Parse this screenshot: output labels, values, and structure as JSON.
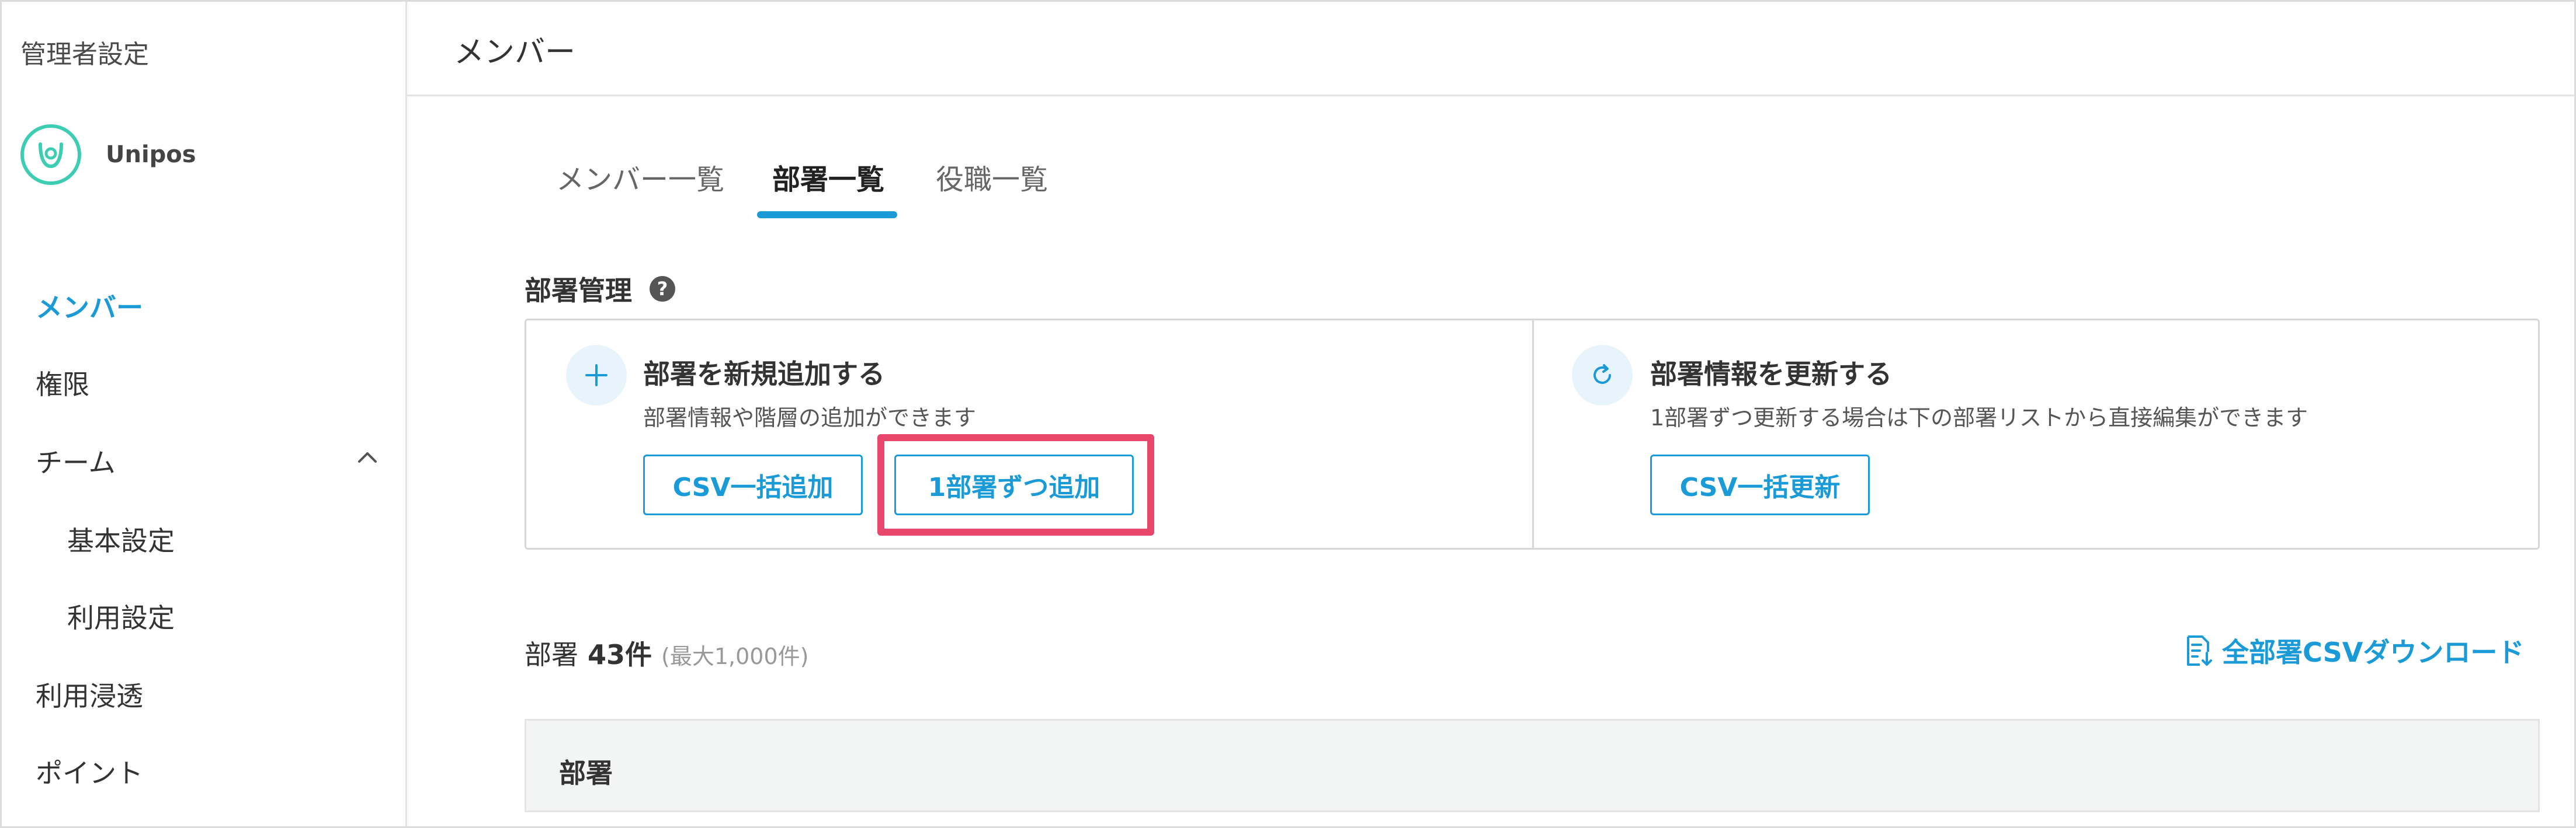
{
  "sidebar": {
    "title": "管理者設定",
    "brand_name": "Unipos",
    "items": [
      {
        "label": "メンバー"
      },
      {
        "label": "権限"
      },
      {
        "label": "チーム"
      },
      {
        "label": "基本設定"
      },
      {
        "label": "利用設定"
      },
      {
        "label": "利用浸透"
      },
      {
        "label": "ポイント"
      }
    ]
  },
  "header": {
    "title": "メンバー"
  },
  "tabs": [
    {
      "label": "メンバー一覧"
    },
    {
      "label": "部署一覧"
    },
    {
      "label": "役職一覧"
    }
  ],
  "section": {
    "title": "部署管理"
  },
  "cards": {
    "add": {
      "title": "部署を新規追加する",
      "desc": "部署情報や階層の追加ができます",
      "btn_csv": "CSV一括追加",
      "btn_single": "1部署ずつ追加"
    },
    "update": {
      "title": "部署情報を更新する",
      "desc": "1部署ずつ更新する場合は下の部署リストから直接編集ができます",
      "btn_csv": "CSV一括更新"
    }
  },
  "list": {
    "label": "部署",
    "count": "43件",
    "max": "(最大1,000件)",
    "download": "全部署CSVダウンロード",
    "column_header": "部署"
  },
  "colors": {
    "accent": "#1a9ad6",
    "highlight": "#e8466a",
    "brand": "#3ccdb2"
  }
}
